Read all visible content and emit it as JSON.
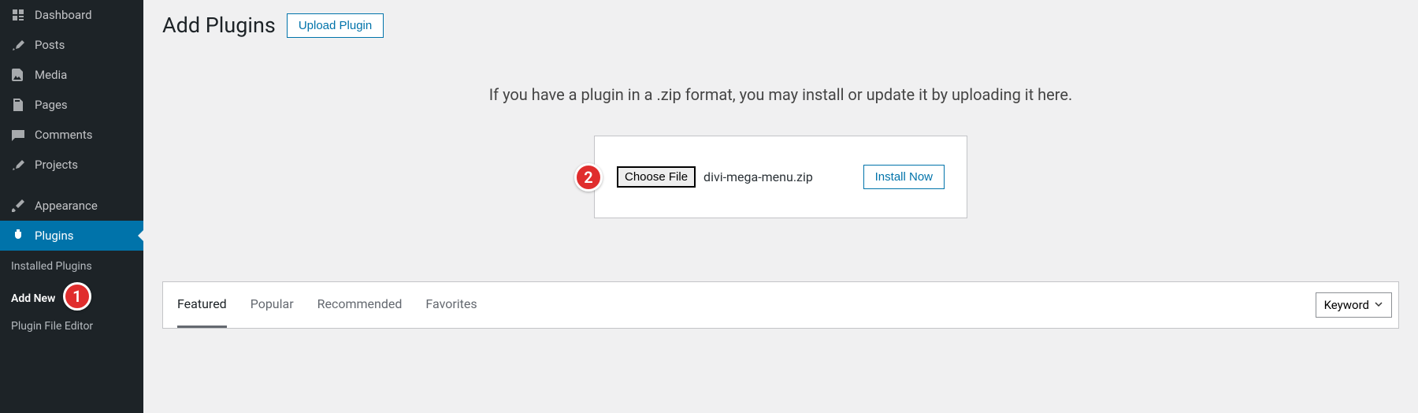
{
  "sidebar": {
    "items": [
      {
        "label": "Dashboard",
        "icon": "dashboard"
      },
      {
        "label": "Posts",
        "icon": "pin"
      },
      {
        "label": "Media",
        "icon": "media"
      },
      {
        "label": "Pages",
        "icon": "pages"
      },
      {
        "label": "Comments",
        "icon": "comments"
      },
      {
        "label": "Projects",
        "icon": "pin"
      },
      {
        "label": "Appearance",
        "icon": "brush"
      },
      {
        "label": "Plugins",
        "icon": "plug",
        "active": true
      }
    ],
    "submenu": [
      {
        "label": "Installed Plugins"
      },
      {
        "label": "Add New",
        "current": true
      },
      {
        "label": "Plugin File Editor"
      }
    ]
  },
  "header": {
    "title": "Add Plugins",
    "upload_button": "Upload Plugin"
  },
  "upload": {
    "message": "If you have a plugin in a .zip format, you may install or update it by uploading it here.",
    "choose_file": "Choose File",
    "selected_file": "divi-mega-menu.zip",
    "install_button": "Install Now"
  },
  "tabs": [
    "Featured",
    "Popular",
    "Recommended",
    "Favorites"
  ],
  "active_tab": "Featured",
  "search_filter_selected": "Keyword",
  "annotations": {
    "step1": "1",
    "step2": "2"
  }
}
